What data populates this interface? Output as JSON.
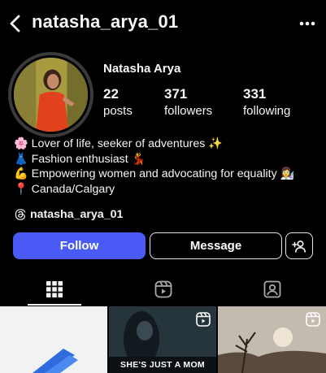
{
  "header": {
    "username": "natasha_arya_01",
    "back_icon": "chevron-left-icon",
    "more_icon": "more-horizontal-icon"
  },
  "profile": {
    "display_name": "Natasha Arya",
    "stats": {
      "posts": {
        "count": "22",
        "label": "posts"
      },
      "followers": {
        "count": "371",
        "label": "followers"
      },
      "following": {
        "count": "331",
        "label": "following"
      }
    },
    "bio": [
      "🌸 Lover of life, seeker of adventures ✨",
      "👗 Fashion enthusiast 💃",
      "💪 Empowering women and advocating for equality 👩‍🔬",
      "📍 Canada/Calgary"
    ],
    "threads_handle": "natasha_arya_01"
  },
  "actions": {
    "follow_label": "Follow",
    "message_label": "Message"
  },
  "colors": {
    "follow_blue": "#4a5bf5",
    "background": "#000000",
    "text": "#f5f5f5"
  },
  "grid": {
    "tiles": [
      {
        "caption": "",
        "is_reel": false
      },
      {
        "caption": "SHE'S JUST A MOM",
        "is_reel": true
      },
      {
        "caption": "",
        "is_reel": true
      }
    ]
  }
}
